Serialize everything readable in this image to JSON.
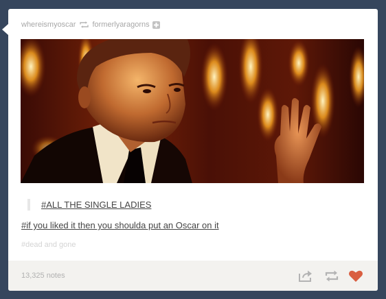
{
  "post": {
    "poster": "whereismyoscar",
    "reblog_icon": "reblog-icon",
    "reblogged_from": "formerlyaragorns",
    "follow_icon": "plus-icon",
    "photo_description": "Man in suit with raised hand, fiery background",
    "quote_tag": "#ALL THE SINGLE LADIES",
    "tag": "#if you liked it then you shoulda put an Oscar on it",
    "faint_tag": "#dead and gone",
    "notes": "13,325 notes",
    "controls": {
      "share_icon": "share-icon",
      "reblog_icon": "reblog-icon",
      "like_icon": "heart-icon"
    }
  },
  "colors": {
    "background": "#36465d",
    "card": "#ffffff",
    "footer": "#f3f2ef",
    "meta_text": "#a7a7a7",
    "link_text": "#444444",
    "like": "#d95e40"
  }
}
